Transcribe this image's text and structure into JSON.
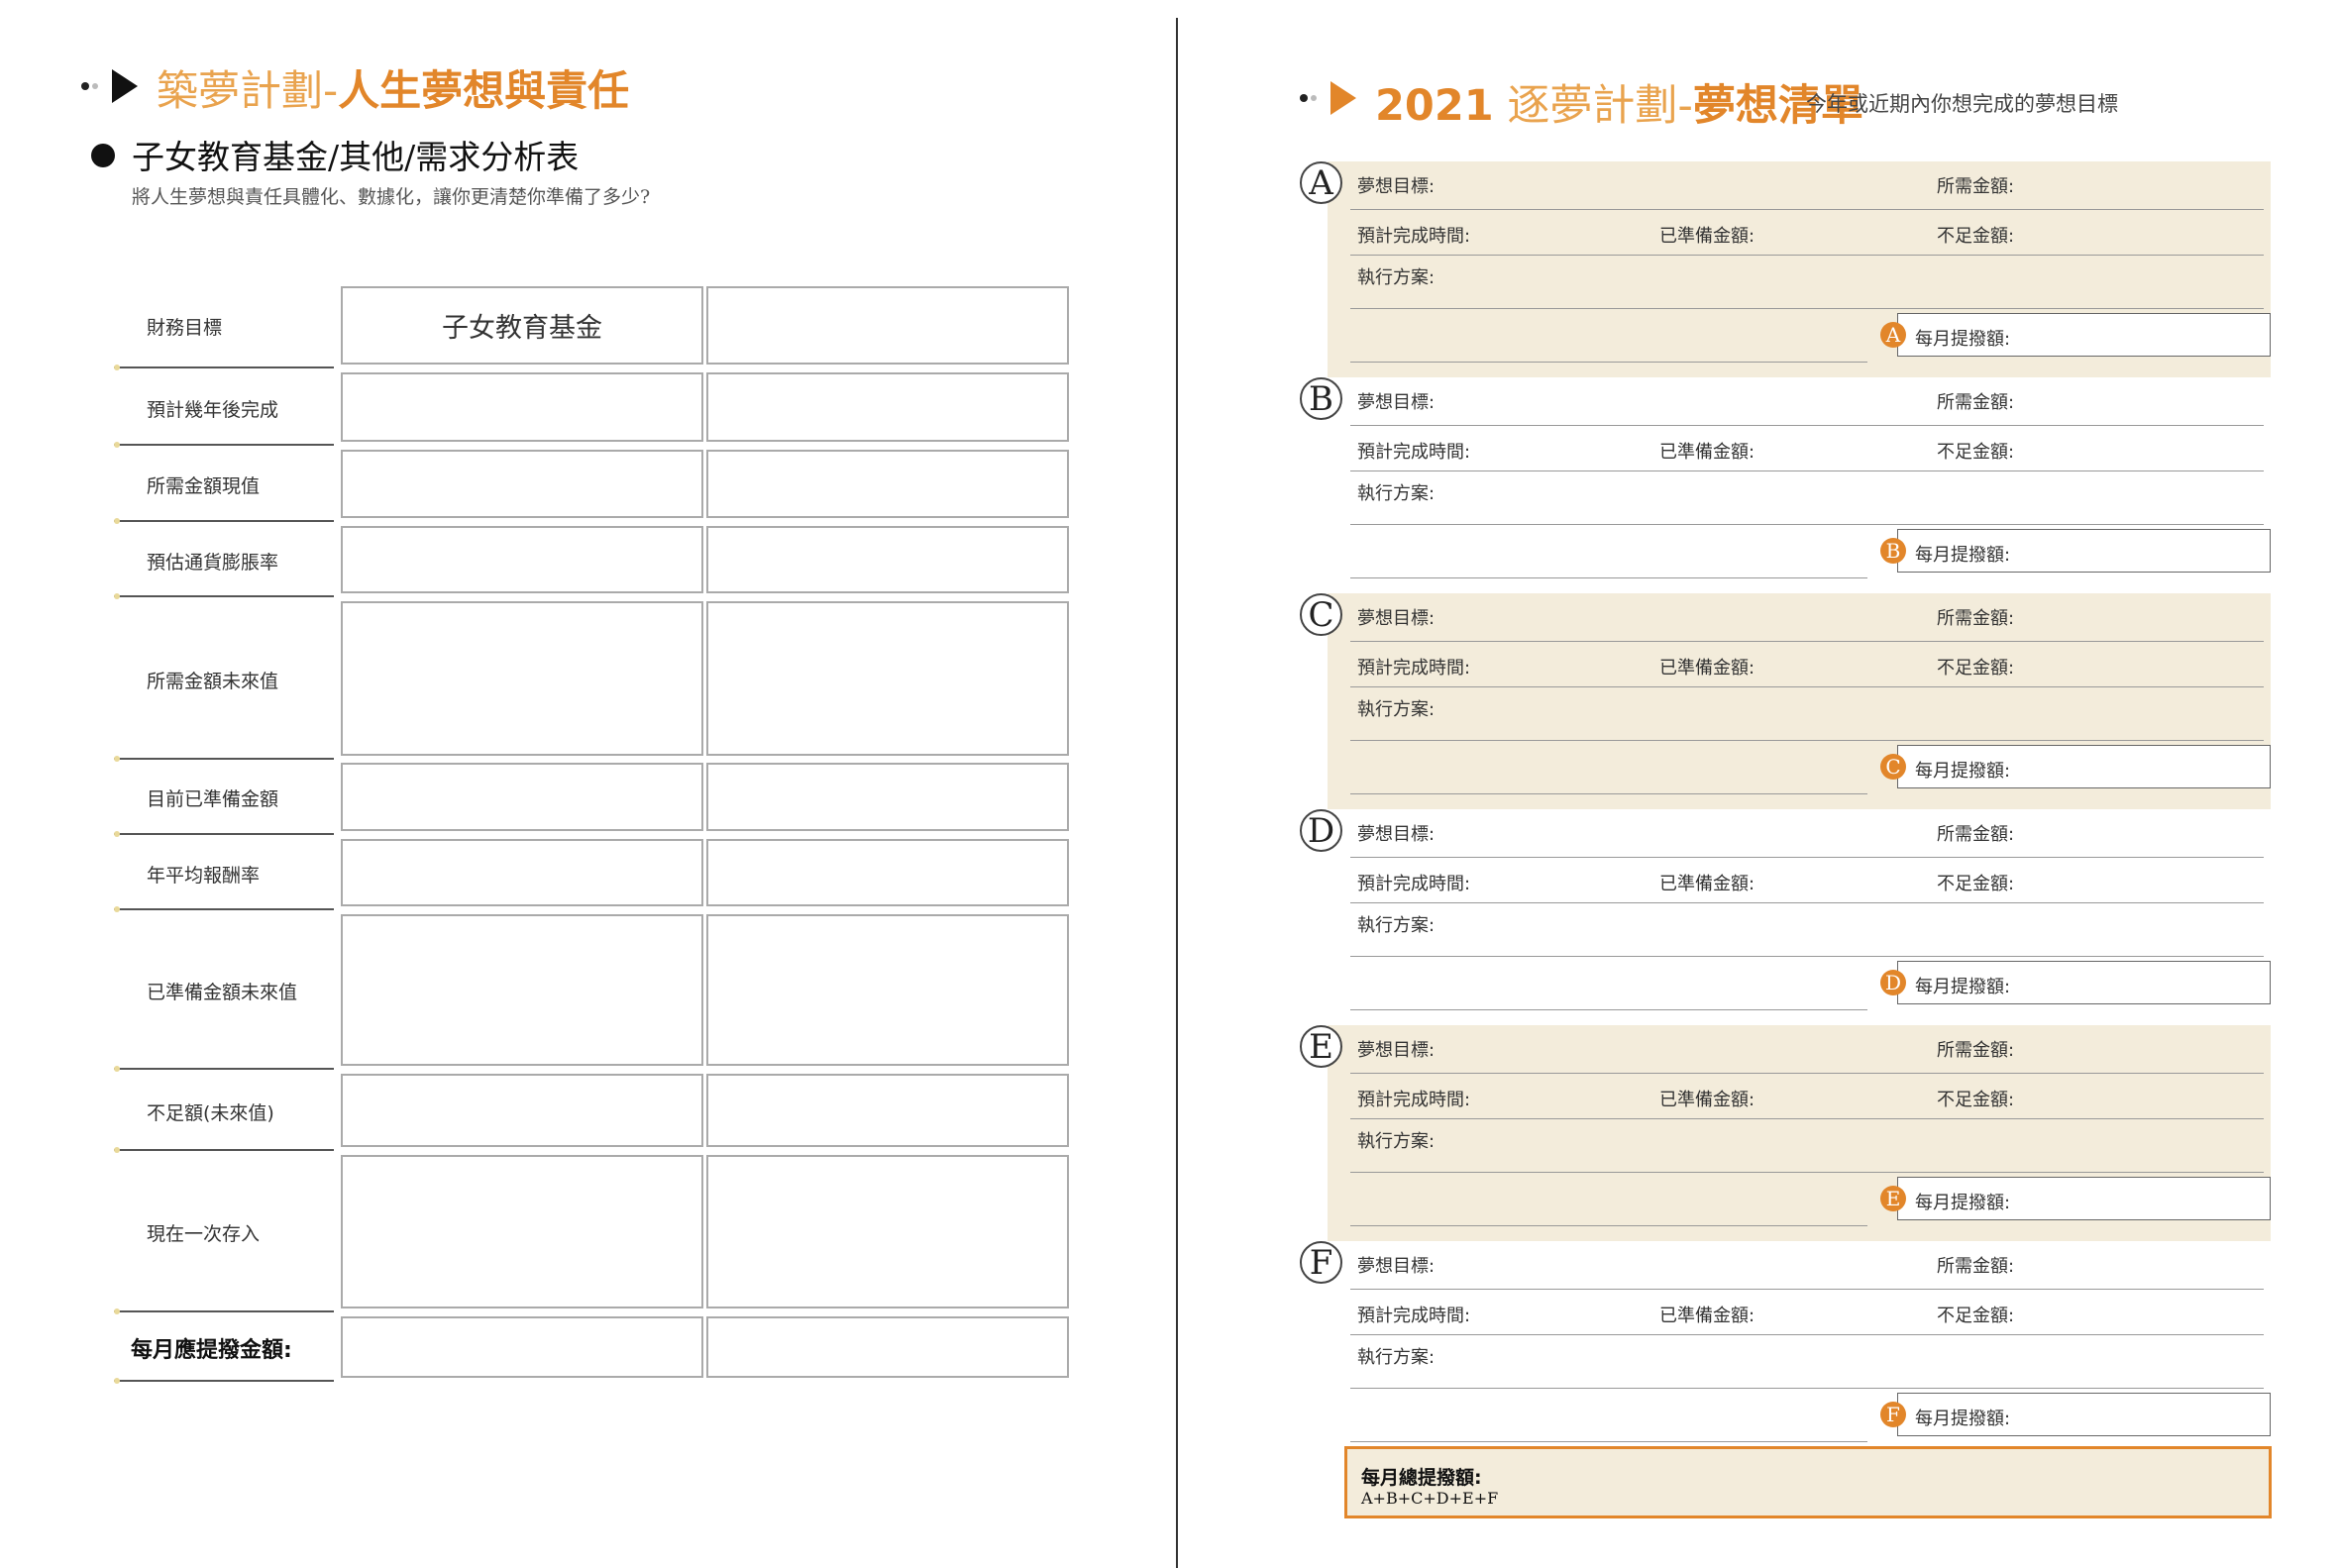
{
  "left": {
    "title_light": "築夢計劃-",
    "title_bold": "人生夢想與責任",
    "subtitle": "子女教育基金/其他/需求分析表",
    "description": "將人生夢想與責任具體化、數據化，讓你更清楚你準備了多少?",
    "rows": [
      {
        "label": "財務目標",
        "col1": "子女教育基金",
        "col2": ""
      },
      {
        "label": "預計幾年後完成",
        "col1": "",
        "col2": ""
      },
      {
        "label": "所需金額現值",
        "col1": "",
        "col2": ""
      },
      {
        "label": "預估通貨膨脹率",
        "col1": "",
        "col2": ""
      },
      {
        "label": "所需金額未來值",
        "col1": "",
        "col2": ""
      },
      {
        "label": "目前已準備金額",
        "col1": "",
        "col2": ""
      },
      {
        "label": "年平均報酬率",
        "col1": "",
        "col2": ""
      },
      {
        "label": "已準備金額未來值",
        "col1": "",
        "col2": ""
      },
      {
        "label": "不足額(未來值)",
        "col1": "",
        "col2": ""
      },
      {
        "label": "現在一次存入",
        "col1": "",
        "col2": ""
      },
      {
        "label": "每月應提撥金額:",
        "col1": "",
        "col2": ""
      }
    ]
  },
  "right": {
    "title_year": "2021",
    "title_light": "逐夢計劃-",
    "title_bold": "夢想清單",
    "description": "今年或近期內你想完成的夢想目標",
    "fields": {
      "goal": "夢想目標:",
      "required": "所需金額:",
      "time": "預計完成時間:",
      "prepared": "已準備金額:",
      "shortfall": "不足金額:",
      "plan": "執行方案:",
      "monthly": "每月提撥額:"
    },
    "blocks": [
      {
        "letter": "A"
      },
      {
        "letter": "B"
      },
      {
        "letter": "C"
      },
      {
        "letter": "D"
      },
      {
        "letter": "E"
      },
      {
        "letter": "F"
      }
    ],
    "total_label": "每月總提撥額:",
    "total_formula": "A+B+C+D+E+F"
  },
  "colors": {
    "accent": "#e2862a",
    "block_bg": "#f3ecdb"
  }
}
